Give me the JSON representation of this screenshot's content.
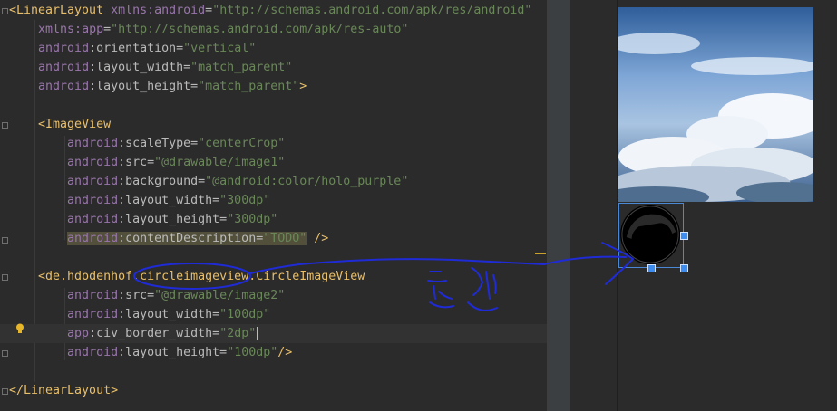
{
  "editor": {
    "lines": [
      {
        "id": "l1",
        "segments": [
          {
            "t": "<LinearLayout ",
            "c": "tag"
          },
          {
            "t": "xmlns:",
            "c": "ns"
          },
          {
            "t": "android",
            "c": "ns"
          },
          {
            "t": "=",
            "c": "attr"
          },
          {
            "t": "\"http://schemas.android.com/apk/res/android\"",
            "c": "val"
          }
        ]
      },
      {
        "id": "l2",
        "segments": [
          {
            "t": "    "
          },
          {
            "t": "xmlns:",
            "c": "ns"
          },
          {
            "t": "app",
            "c": "ns"
          },
          {
            "t": "=",
            "c": "attr"
          },
          {
            "t": "\"http://schemas.android.com/apk/res-auto\"",
            "c": "val"
          }
        ]
      },
      {
        "id": "l3",
        "segments": [
          {
            "t": "    "
          },
          {
            "t": "android",
            "c": "ns"
          },
          {
            "t": ":orientation=",
            "c": "attr"
          },
          {
            "t": "\"vertical\"",
            "c": "val"
          }
        ]
      },
      {
        "id": "l4",
        "segments": [
          {
            "t": "    "
          },
          {
            "t": "android",
            "c": "ns"
          },
          {
            "t": ":layout_width=",
            "c": "attr"
          },
          {
            "t": "\"match_parent\"",
            "c": "val"
          }
        ]
      },
      {
        "id": "l5",
        "segments": [
          {
            "t": "    "
          },
          {
            "t": "android",
            "c": "ns"
          },
          {
            "t": ":layout_height=",
            "c": "attr"
          },
          {
            "t": "\"match_parent\"",
            "c": "val"
          },
          {
            "t": ">",
            "c": "tag"
          }
        ]
      },
      {
        "id": "l6",
        "segments": []
      },
      {
        "id": "l7",
        "segments": [
          {
            "t": "    "
          },
          {
            "t": "<ImageView",
            "c": "tag"
          }
        ]
      },
      {
        "id": "l8",
        "segments": [
          {
            "t": "        "
          },
          {
            "t": "android",
            "c": "ns"
          },
          {
            "t": ":scaleType=",
            "c": "attr"
          },
          {
            "t": "\"centerCrop\"",
            "c": "val"
          }
        ]
      },
      {
        "id": "l9",
        "segments": [
          {
            "t": "        "
          },
          {
            "t": "android",
            "c": "ns"
          },
          {
            "t": ":src=",
            "c": "attr"
          },
          {
            "t": "\"@drawable/image1\"",
            "c": "val"
          }
        ]
      },
      {
        "id": "l10",
        "segments": [
          {
            "t": "        "
          },
          {
            "t": "android",
            "c": "ns"
          },
          {
            "t": ":background=",
            "c": "attr"
          },
          {
            "t": "\"@android:color/holo_purple\"",
            "c": "val"
          }
        ]
      },
      {
        "id": "l11",
        "segments": [
          {
            "t": "        "
          },
          {
            "t": "android",
            "c": "ns"
          },
          {
            "t": ":layout_width=",
            "c": "attr"
          },
          {
            "t": "\"300dp\"",
            "c": "val"
          }
        ]
      },
      {
        "id": "l12",
        "segments": [
          {
            "t": "        "
          },
          {
            "t": "android",
            "c": "ns"
          },
          {
            "t": ":layout_height=",
            "c": "attr"
          },
          {
            "t": "\"300dp\"",
            "c": "val"
          }
        ]
      },
      {
        "id": "l13",
        "segments": [
          {
            "t": "        "
          },
          {
            "t": "android",
            "c": "ns",
            "h": 1
          },
          {
            "t": ":contentDescription=",
            "c": "attr",
            "h": 1
          },
          {
            "t": "\"TODO\"",
            "c": "val",
            "h": 1
          },
          {
            "t": " "
          },
          {
            "t": "/>",
            "c": "tag"
          }
        ]
      },
      {
        "id": "l14",
        "segments": []
      },
      {
        "id": "l15",
        "segments": [
          {
            "t": "    "
          },
          {
            "t": "<de.hdodenhof.circleimageview.CircleImageView",
            "c": "tag"
          }
        ]
      },
      {
        "id": "l16",
        "segments": [
          {
            "t": "        "
          },
          {
            "t": "android",
            "c": "ns"
          },
          {
            "t": ":src=",
            "c": "attr"
          },
          {
            "t": "\"@drawable/image2\"",
            "c": "val"
          }
        ]
      },
      {
        "id": "l17",
        "segments": [
          {
            "t": "        "
          },
          {
            "t": "android",
            "c": "ns"
          },
          {
            "t": ":layout_width=",
            "c": "attr"
          },
          {
            "t": "\"100dp\"",
            "c": "val"
          }
        ]
      },
      {
        "id": "l18",
        "cur": 1,
        "segments": [
          {
            "t": "        "
          },
          {
            "t": "app",
            "c": "ns"
          },
          {
            "t": ":civ_border_width=",
            "c": "attr"
          },
          {
            "t": "\"2dp\"",
            "c": "val"
          },
          {
            "t": "",
            "caret": 1
          }
        ]
      },
      {
        "id": "l19",
        "segments": [
          {
            "t": "        "
          },
          {
            "t": "android",
            "c": "ns"
          },
          {
            "t": ":layout_height=",
            "c": "attr"
          },
          {
            "t": "\"100dp\"",
            "c": "val"
          },
          {
            "t": "/>",
            "c": "tag"
          }
        ]
      },
      {
        "id": "l20",
        "segments": []
      },
      {
        "id": "l21",
        "segments": [
          {
            "t": "</LinearLayout>",
            "c": "tag"
          }
        ]
      }
    ]
  },
  "annotation": {
    "ink_color": "#1f2bd6"
  },
  "preview": {
    "selection_color": "#3d8cf0"
  }
}
